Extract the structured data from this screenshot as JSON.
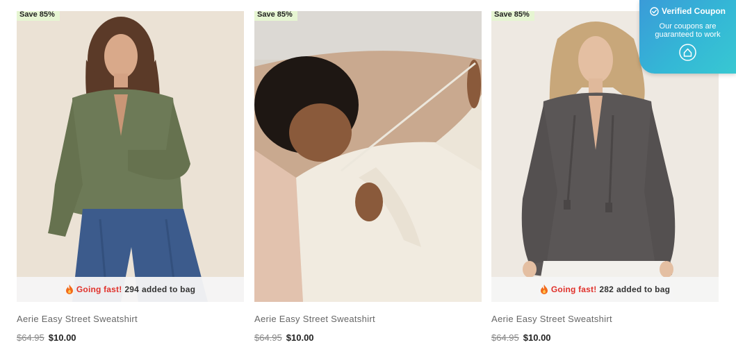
{
  "products": [
    {
      "badge": "Save 85%",
      "fast_label": "Going fast!",
      "added_count": "294",
      "added_text": "added to bag",
      "title": "Aerie Easy Street Sweatshirt",
      "old_price": "$64.95",
      "new_price": "$10.00"
    },
    {
      "badge": "Save 85%",
      "title": "Aerie Easy Street Sweatshirt",
      "old_price": "$64.95",
      "new_price": "$10.00"
    },
    {
      "badge": "Save 85%",
      "fast_label": "Going fast!",
      "added_count": "282",
      "added_text": "added to bag",
      "title": "Aerie Easy Street Sweatshirt",
      "old_price": "$64.95",
      "new_price": "$10.00"
    }
  ],
  "coupon": {
    "title": "Verified Coupon",
    "subtitle": "Our coupons are guaranteed to work"
  },
  "colors": {
    "badge_bg": "#e6f5d2",
    "fast_red": "#e0312b",
    "coupon_start": "#3a9bd8",
    "coupon_end": "#38c8d2"
  },
  "icons": {
    "flame": "flame-icon",
    "check": "check-circle-icon",
    "logo": "coupon-logo-icon"
  }
}
